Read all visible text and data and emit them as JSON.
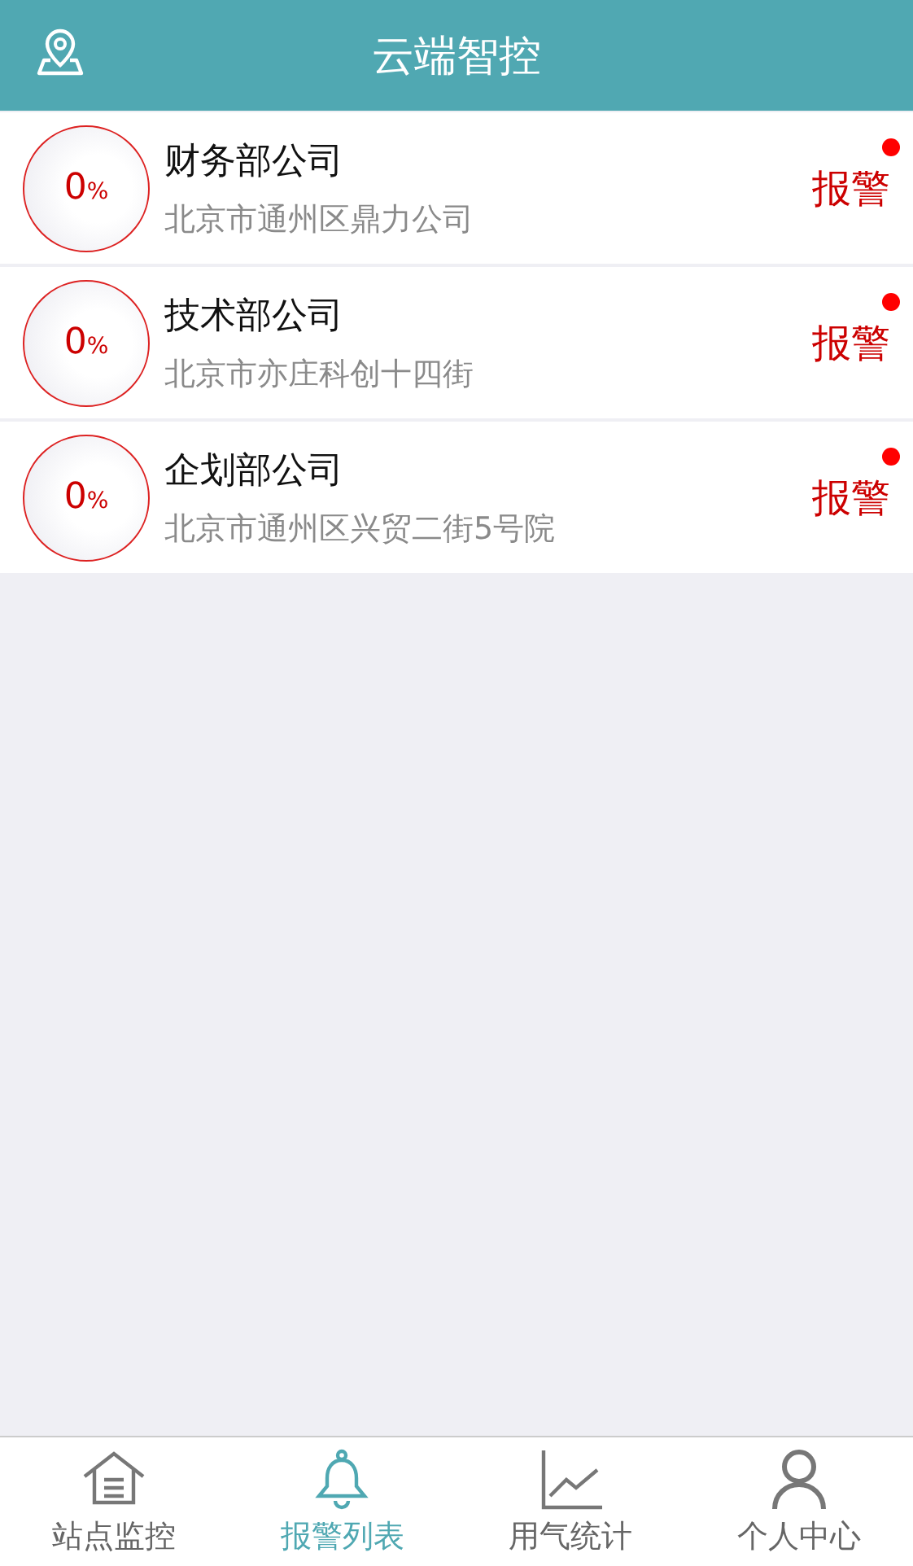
{
  "header": {
    "title": "云端智控"
  },
  "stations": [
    {
      "percent": "0",
      "unit": "%",
      "name": "财务部公司",
      "address": "北京市通州区鼎力公司",
      "status": "报警",
      "unread": true
    },
    {
      "percent": "0",
      "unit": "%",
      "name": "技术部公司",
      "address": "北京市亦庄科创十四街",
      "status": "报警",
      "unread": true
    },
    {
      "percent": "0",
      "unit": "%",
      "name": "企划部公司",
      "address": "北京市通州区兴贸二街5号院",
      "status": "报警",
      "unread": true
    }
  ],
  "tabs": [
    {
      "kind": "home",
      "label": "站点监控",
      "selected": false
    },
    {
      "kind": "bell",
      "label": "报警列表",
      "selected": true
    },
    {
      "kind": "chart",
      "label": "用气统计",
      "selected": false
    },
    {
      "kind": "person",
      "label": "个人中心",
      "selected": false
    }
  ]
}
